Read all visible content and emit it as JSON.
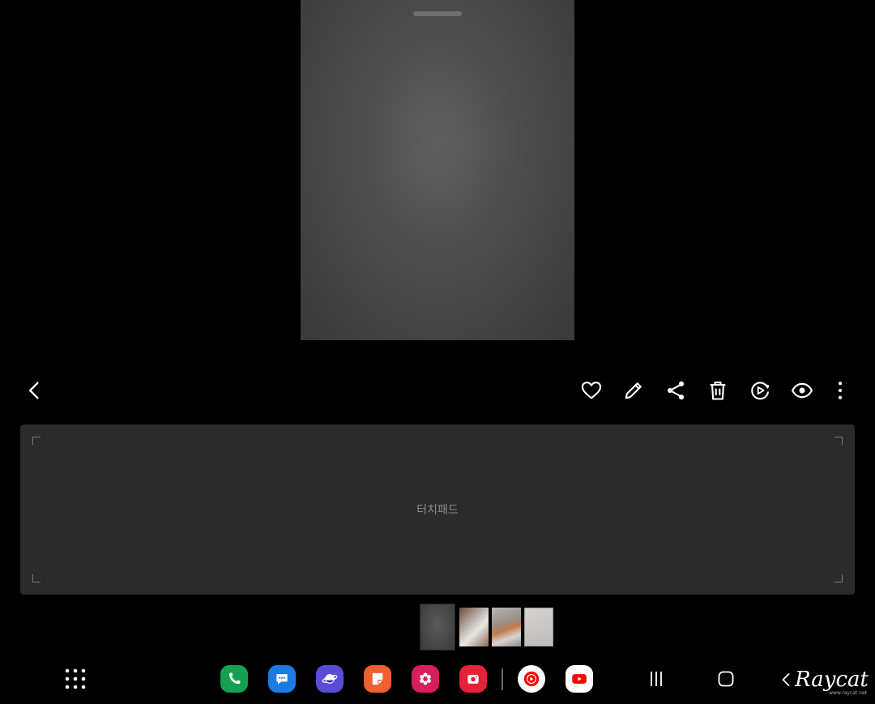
{
  "viewer": {
    "toolbar_icons": [
      "back-icon",
      "heart-icon",
      "edit-icon",
      "share-icon",
      "trash-icon",
      "motion-play-icon",
      "eye-icon",
      "more-icon"
    ]
  },
  "touchpad": {
    "label": "터치패드"
  },
  "thumbnails": [
    {
      "name": "current-photo",
      "selected": true
    },
    {
      "name": "earbuds-in-hand-photo",
      "selected": false
    },
    {
      "name": "earbud-in-ear-photo",
      "selected": false
    },
    {
      "name": "gray-photo",
      "selected": false
    }
  ],
  "taskbar": {
    "apps": [
      "phone",
      "messages",
      "samsung-internet",
      "samsung-notes",
      "gallery",
      "camera",
      "youtube-music",
      "youtube"
    ],
    "colors": {
      "phone": "#14a152",
      "messages": "#1b7be0",
      "samsung-internet": "#5b4cd6",
      "samsung-notes": "#f0612f",
      "gallery": "#d81e5b",
      "camera": "#e5223a",
      "youtube-music": "#ffffff",
      "youtube": "#ffffff"
    }
  },
  "watermark": {
    "text": "Raycat",
    "url": "www.raycat.net"
  }
}
